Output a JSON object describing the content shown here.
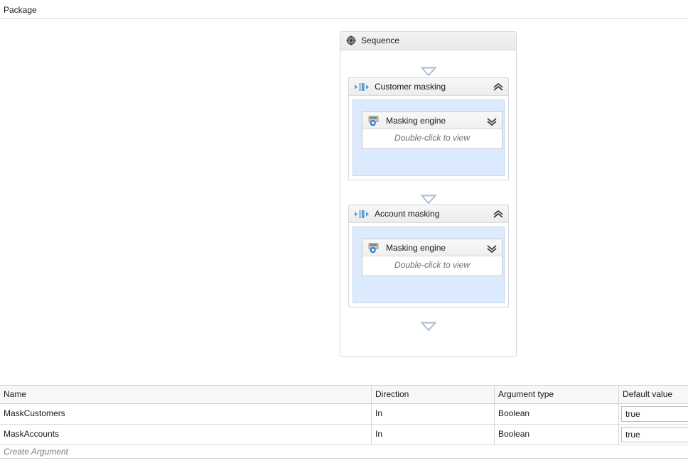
{
  "breadcrumb": {
    "text": "Package"
  },
  "designer": {
    "sequence": {
      "title": "Sequence",
      "move_icon": "move-handle-icon",
      "connector_icon": "down-arrow-connector-icon",
      "activities": [
        {
          "title": "Customer masking",
          "icon": "sequence-activity-icon",
          "collapse_icon": "chevron-double-up-icon",
          "inner": {
            "title": "Masking engine",
            "icon": "masking-engine-gear-icon",
            "expand_icon": "chevron-double-down-icon",
            "hint": "Double-click to view"
          }
        },
        {
          "title": "Account masking",
          "icon": "sequence-activity-icon",
          "collapse_icon": "chevron-double-up-icon",
          "inner": {
            "title": "Masking engine",
            "icon": "masking-engine-gear-icon",
            "expand_icon": "chevron-double-down-icon",
            "hint": "Double-click to view"
          }
        }
      ]
    }
  },
  "arguments_panel": {
    "columns": [
      {
        "label": "Name"
      },
      {
        "label": "Direction"
      },
      {
        "label": "Argument type"
      },
      {
        "label": "Default value"
      }
    ],
    "rows": [
      {
        "name": "MaskCustomers",
        "direction": "In",
        "type": "Boolean",
        "default": "true"
      },
      {
        "name": "MaskAccounts",
        "direction": "In",
        "type": "Boolean",
        "default": "true"
      }
    ],
    "create_row_label": "Create Argument"
  },
  "colors": {
    "activity_body_blue": "#dbeafc",
    "activity_body_border": "#c2d9f2",
    "connector_stroke": "#9fb0cc",
    "connector_fill": "#ffffff",
    "icon_blue": "#3f7fc8",
    "panel_border": "#d2d6de"
  }
}
